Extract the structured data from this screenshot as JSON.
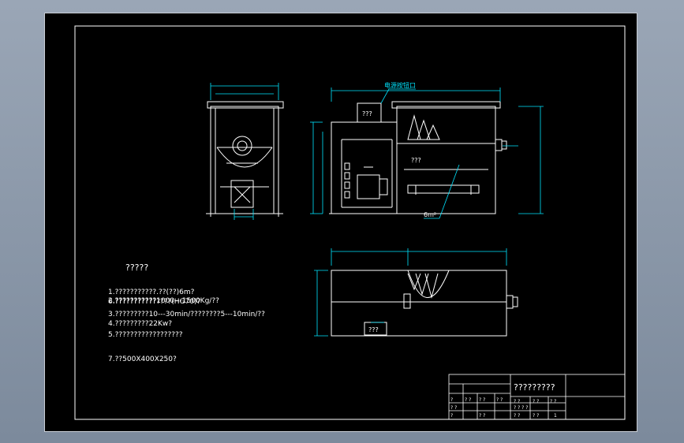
{
  "sheet": {
    "label_motor_top": "电源按钮口",
    "label_motor_box": "???",
    "label_elevation_mid": "???",
    "label_area": "6m²",
    "label_plan_box": "???"
  },
  "requirements": {
    "heading": "?????",
    "items": [
      "1.???????????.??(??)6m?",
      "2.???????????1000---1500Kg/??",
      "3.?????????10---30min/????????5---10min/??",
      "4.?????????22Kw?",
      "5.??????????????????",
      "7.??500X400X250?"
    ],
    "overlap_text": "6.???????????????(HG70)?"
  },
  "title_block": {
    "title": "?????????",
    "cells": [
      "?",
      "? ?",
      "? ?",
      "? ?",
      "? ?",
      "? ?",
      "?",
      "? ?",
      "? ? ? ?",
      "? ?",
      "? ?",
      "? ?",
      "? ?",
      "1"
    ]
  },
  "colors": {
    "background": "#000000",
    "line": "#ffffff",
    "dimension": "#00e5ff",
    "accent": "#00c8ff"
  }
}
